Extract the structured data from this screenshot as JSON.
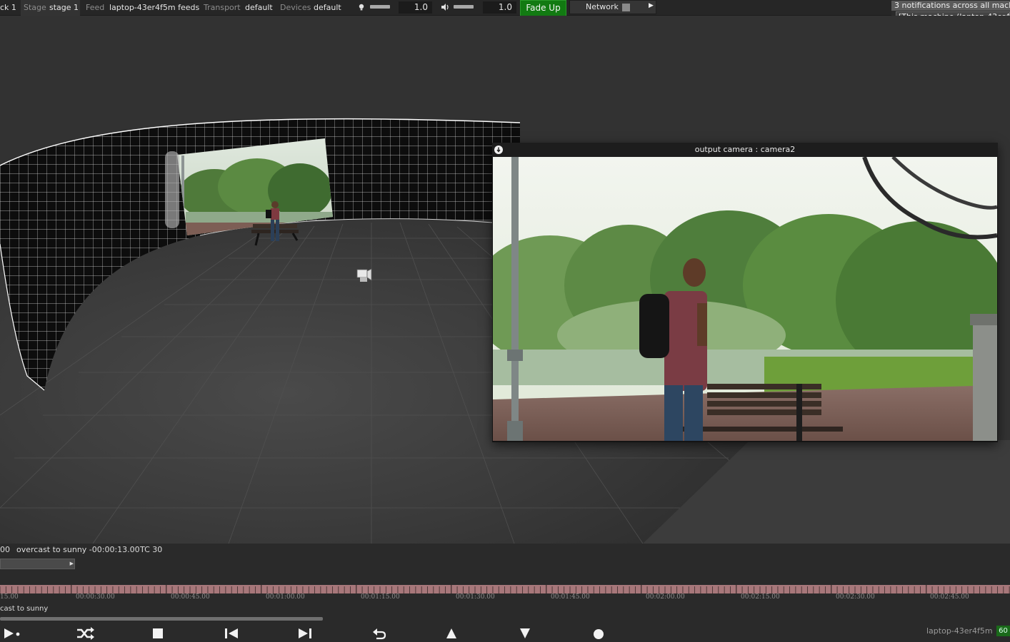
{
  "topbar": {
    "cut_label": "ck 1",
    "stage_label": "Stage",
    "stage_value": "stage 1",
    "feed_label": "Feed",
    "feed_value": "laptop-43er4f5m feeds",
    "transport_label": "Transport",
    "transport_value": "default",
    "devices_label": "Devices",
    "devices_value": "default",
    "brightness_value": "1.0",
    "volume_value": "1.0",
    "fade_up_label": "Fade Up",
    "network_label": "Network",
    "notifications_count_text": "3 notifications across all machin",
    "notifications_machine_text": "[This machine (laptop-43er4f5m"
  },
  "viewport": {
    "camera_window_title": "output camera : camera2"
  },
  "timeline": {
    "prev_cue_time": "00",
    "current_cue": "overcast to sunny -00:00:13.00",
    "tc_label": "TC 30",
    "ruler_labels": [
      "15.00",
      "00:00:30.00",
      "00:00:45.00",
      "00:01:00.00",
      "00:01:15.00",
      "00:01:30.00",
      "00:01:45.00",
      "00:02:00.00",
      "00:02:15.00",
      "00:02:30.00",
      "00:02:45.00"
    ],
    "cue_name": "cast to sunny",
    "cue_progress": 0.32
  },
  "transport_controls": [
    "play-cue-icon",
    "shuffle-icon",
    "stop-icon",
    "skip-back-icon",
    "skip-forward-icon",
    "undo-icon",
    "up-icon",
    "down-icon",
    "record-icon"
  ],
  "status": {
    "machine_name": "laptop-43er4f5m",
    "fps": "60"
  }
}
